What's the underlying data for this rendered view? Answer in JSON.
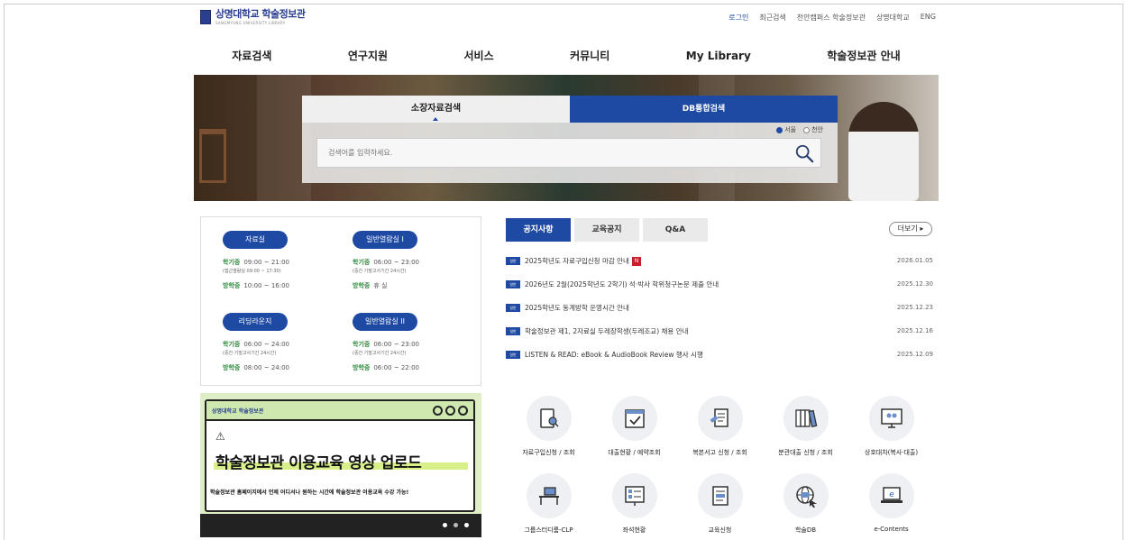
{
  "header": {
    "logo_text": "상명대학교 학술정보관",
    "logo_sub": "SANGMYUNG UNIVERSITY LIBRARY",
    "util_links": [
      "로그인",
      "최근검색",
      "천안캠퍼스 학술정보관",
      "상명대학교",
      "ENG"
    ]
  },
  "gnb": [
    "자료검색",
    "연구지원",
    "서비스",
    "커뮤니티",
    "My Library",
    "학술정보관 안내"
  ],
  "search": {
    "tab_holdings": "소장자료검색",
    "tab_db": "DB통합검색",
    "radio_seoul": "서울",
    "radio_cheonan": "천안",
    "placeholder": "검색어를 입력하세요."
  },
  "hours": [
    {
      "name": "자료실",
      "lines": [
        {
          "k": "학기중",
          "v": "09:00 ~ 21:00",
          "sub": "(접근열람실 09:00 ~ 17:30)"
        },
        {
          "k": "방학중",
          "v": "10:00 ~ 16:00",
          "sub": ""
        }
      ]
    },
    {
      "name": "일반열람실 I",
      "lines": [
        {
          "k": "학기중",
          "v": "06:00 ~ 23:00",
          "sub": "(중간·기말고사기간 24시간)"
        },
        {
          "k": "방학중",
          "v": "휴 실",
          "sub": ""
        }
      ]
    },
    {
      "name": "리딩라운지",
      "lines": [
        {
          "k": "학기중",
          "v": "06:00 ~ 24:00",
          "sub": "(중간·기말고사기간 24시간)"
        },
        {
          "k": "방학중",
          "v": "08:00 ~ 24:00",
          "sub": ""
        }
      ]
    },
    {
      "name": "일반열람실 II",
      "lines": [
        {
          "k": "학기중",
          "v": "06:00 ~ 23:00",
          "sub": "(중간·기말고사기간 24시간)"
        },
        {
          "k": "방학중",
          "v": "06:00 ~ 22:00",
          "sub": ""
        }
      ]
    }
  ],
  "banner": {
    "logo": "상명대학교 학술정보관",
    "title": "학술정보관 이용교육 영상 업로드",
    "subtitle": "학술정보관 홈페이지에서 언제 어디서나 원하는 시간에 학술정보관 이용교육 수강 가능!"
  },
  "notices": {
    "tabs": [
      "공지사항",
      "교육공지",
      "Q&A"
    ],
    "more": "더보기",
    "badge": "일반",
    "new_mark": "N",
    "items": [
      {
        "title": "2025학년도 자료구입신청 마감 안내",
        "date": "2026.01.05",
        "new": true
      },
      {
        "title": "2026년도 2월(2025학년도 2학기) 석·박사 학위청구논문 제출 안내",
        "date": "2025.12.30",
        "new": false
      },
      {
        "title": "2025학년도 동계방학 운영시간 안내",
        "date": "2025.12.23",
        "new": false
      },
      {
        "title": "학술정보관 제1, 2자료실 두레장학생(두레조교) 채용 안내",
        "date": "2025.12.16",
        "new": false
      },
      {
        "title": "LISTEN & READ: eBook & AudioBook Review 행사 시행",
        "date": "2025.12.09",
        "new": false
      }
    ]
  },
  "quick_menu": [
    {
      "label": "자료구입신청 / 조회",
      "icon": "book-search-icon"
    },
    {
      "label": "대출현황 / 예약조회",
      "icon": "calendar-check-icon"
    },
    {
      "label": "복본서고 신청 / 조회",
      "icon": "document-icon"
    },
    {
      "label": "분관대출 신청 / 조회",
      "icon": "bookshelf-icon"
    },
    {
      "label": "상호대차(복사·대출)",
      "icon": "monitor-people-icon"
    },
    {
      "label": "그룹스터디룸-CLP",
      "icon": "desk-icon"
    },
    {
      "label": "좌석현황",
      "icon": "seat-board-icon"
    },
    {
      "label": "교육신청",
      "icon": "form-icon"
    },
    {
      "label": "학술DB",
      "icon": "globe-db-icon"
    },
    {
      "label": "e-Contents",
      "icon": "laptop-e-icon"
    }
  ],
  "colors": {
    "primary": "#1e4aa3",
    "green": "#2e8b3c",
    "new": "#c8202a"
  }
}
